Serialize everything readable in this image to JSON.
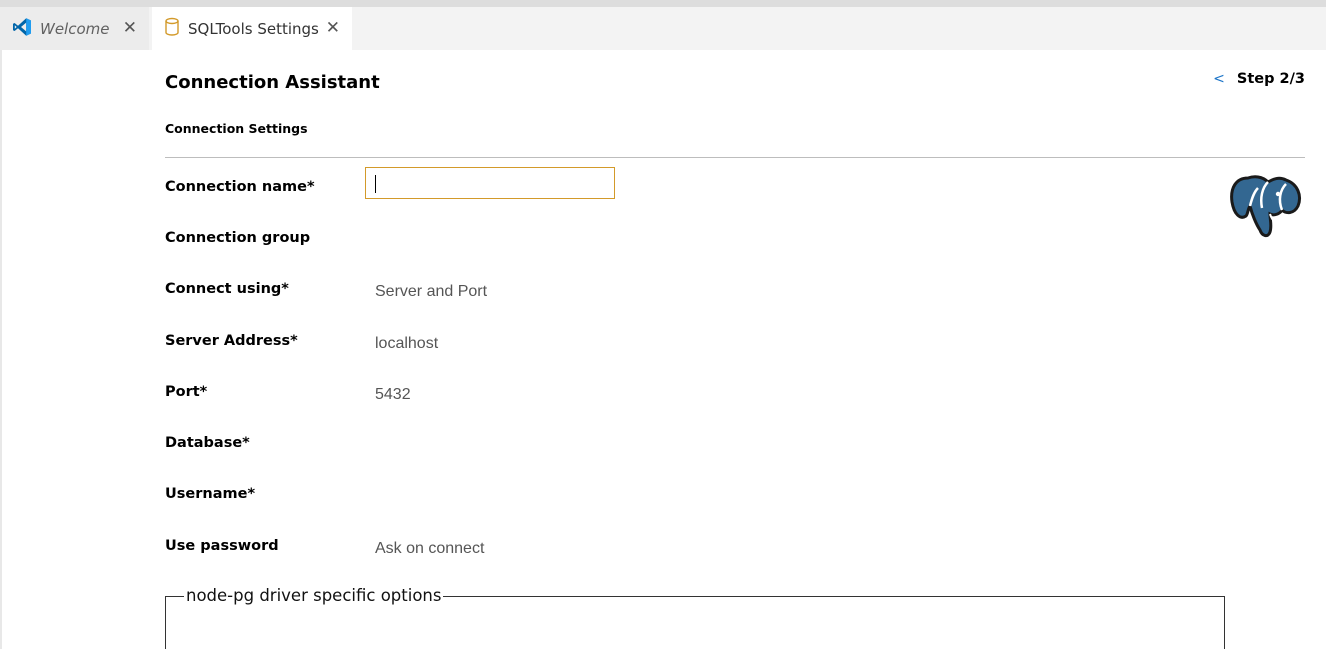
{
  "tabs": [
    {
      "label": "Welcome",
      "icon": "vscode-logo-icon",
      "state": "inactive"
    },
    {
      "label": "SQLTools Settings",
      "icon": "database-icon",
      "state": "active"
    }
  ],
  "header": {
    "title": "Connection Assistant",
    "back_glyph": "<",
    "step": "Step 2/3",
    "subtitle": "Connection Settings"
  },
  "form": {
    "connection_name": {
      "label": "Connection name*",
      "value": ""
    },
    "connection_group": {
      "label": "Connection group",
      "value": ""
    },
    "connect_using": {
      "label": "Connect using*",
      "value": "Server and Port"
    },
    "server_address": {
      "label": "Server Address*",
      "value": "localhost"
    },
    "port": {
      "label": "Port*",
      "value": "5432"
    },
    "database": {
      "label": "Database*",
      "value": ""
    },
    "username": {
      "label": "Username*",
      "value": ""
    },
    "use_password": {
      "label": "Use password",
      "value": "Ask on connect"
    }
  },
  "driver_options": {
    "legend": "node-pg driver specific options"
  },
  "colors": {
    "accent_link": "#1a73c7",
    "focus_border": "#d39a2a",
    "postgres_blue": "#336791",
    "vscode_blue": "#0065a9"
  }
}
